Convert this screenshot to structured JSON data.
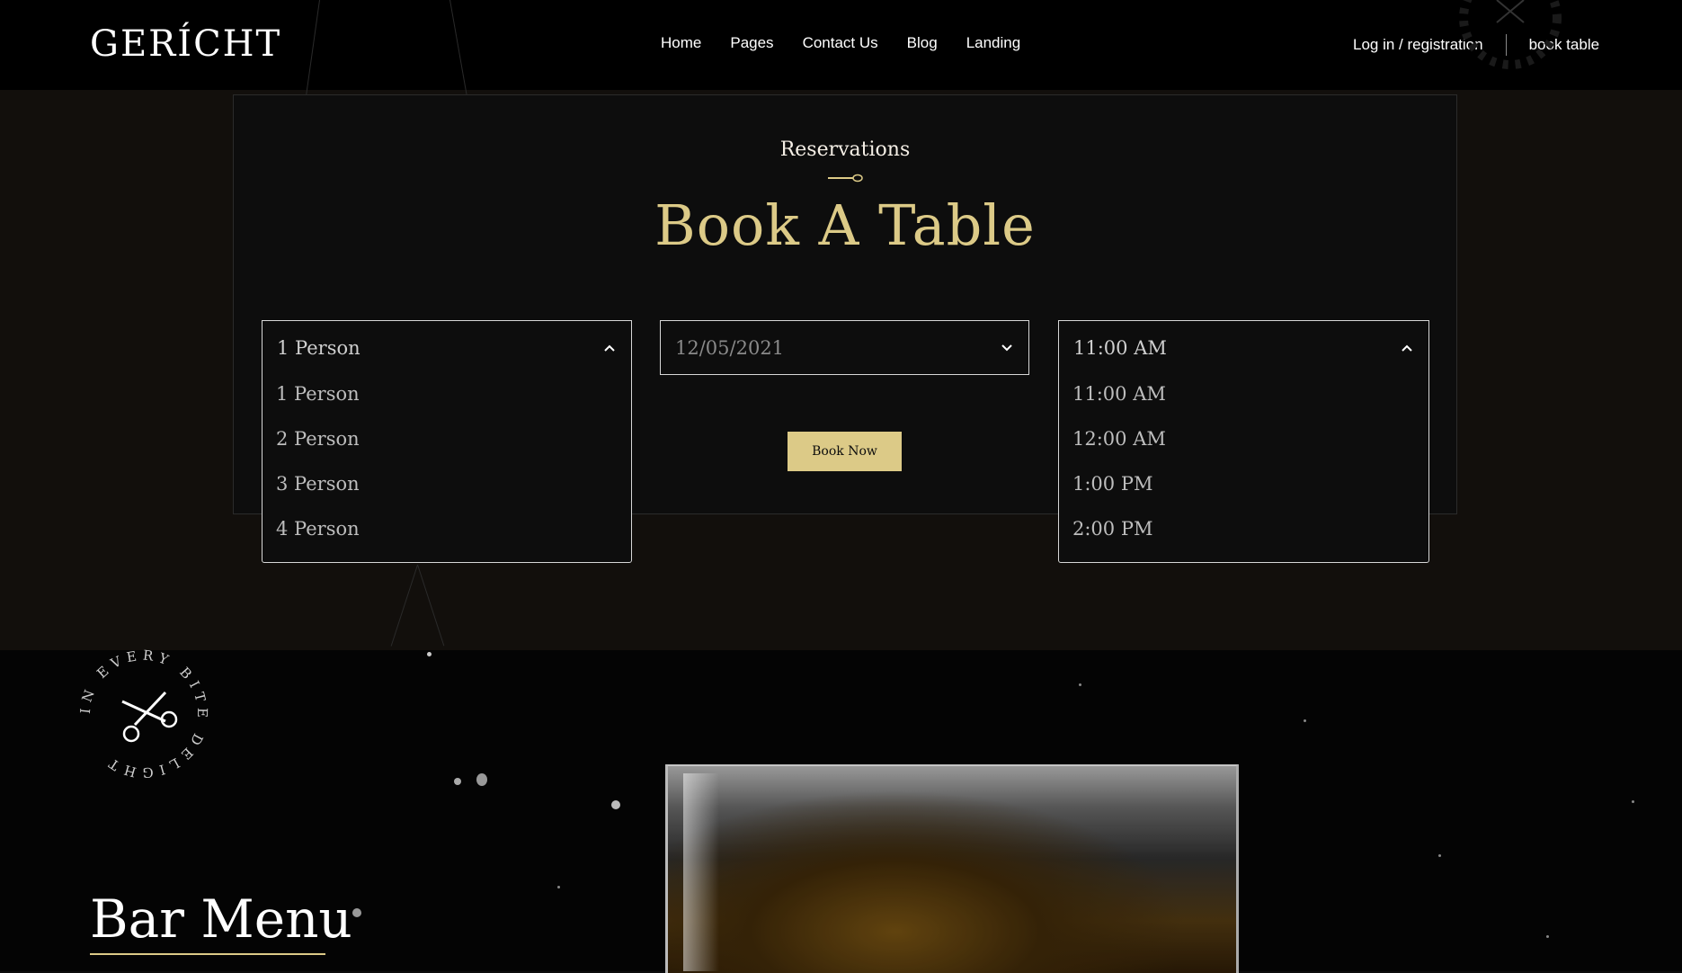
{
  "nav": {
    "logo": "GERÍCHT",
    "links": [
      "Home",
      "Pages",
      "Contact Us",
      "Blog",
      "Landing"
    ],
    "login": "Log in / registration",
    "book_table": "book table"
  },
  "reservation": {
    "subtitle": "Reservations",
    "title": "Book A Table",
    "person_select": {
      "value": "1 Person",
      "options": [
        "1 Person",
        "2 Person",
        "3 Person",
        "4 Person"
      ]
    },
    "date_input": {
      "value": "12/05/2021"
    },
    "time_select": {
      "value": "11:00 AM",
      "options": [
        "11:00 AM",
        "12:00 AM",
        "1:00 PM",
        "2:00 PM"
      ]
    },
    "book_button": "Book Now"
  },
  "bar": {
    "title": "Bar Menu",
    "badge_text": "IN EVERY BITE DELIGHT"
  },
  "colors": {
    "accent": "#dcca87",
    "background": "#0c0c0c"
  }
}
